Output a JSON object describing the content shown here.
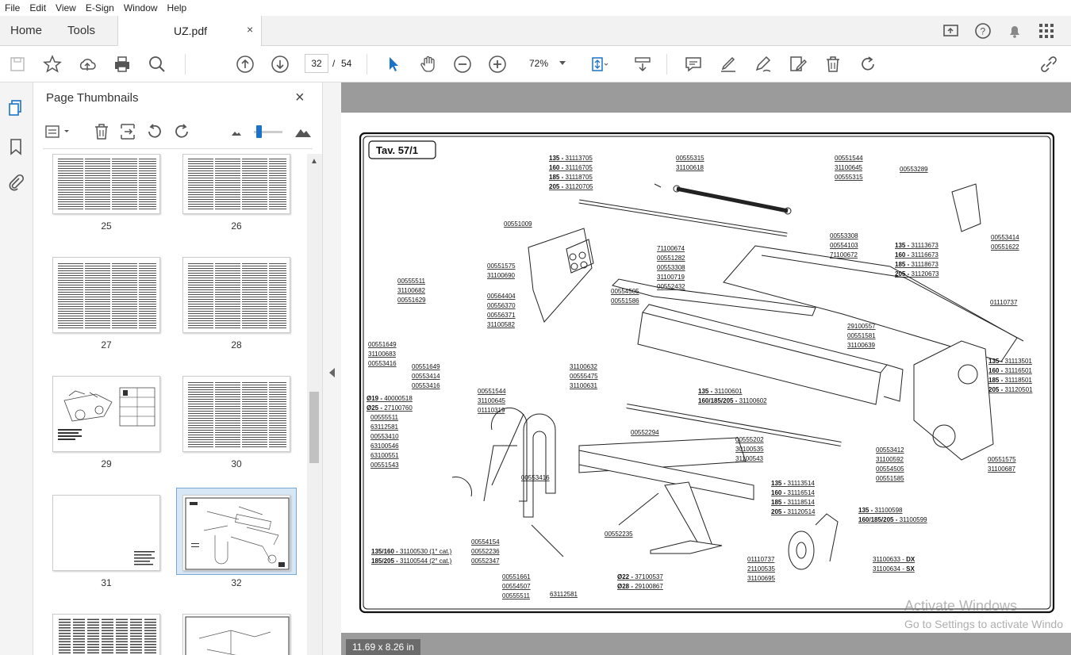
{
  "menu": [
    "File",
    "Edit",
    "View",
    "E-Sign",
    "Window",
    "Help"
  ],
  "tabs": {
    "home": "Home",
    "tools": "Tools",
    "document": "UZ.pdf",
    "close": "×"
  },
  "toolbar": {
    "current_page": "32",
    "separator": "/",
    "total_pages": "54",
    "zoom": "72%"
  },
  "thumbnails_panel": {
    "title": "Page Thumbnails",
    "close": "×",
    "pages": [
      "25",
      "26",
      "27",
      "28",
      "29",
      "30",
      "31",
      "32"
    ],
    "selected": "32"
  },
  "drawing": {
    "title": "Tav. 57/1",
    "callouts": [
      {
        "lines": [
          {
            "text": "135 - ",
            "bold": true
          },
          {
            "text": "31113705"
          }
        ]
      },
      {
        "lines": [
          {
            "text": "160 - ",
            "bold": true
          },
          {
            "text": "31116705"
          }
        ]
      },
      {
        "lines": [
          {
            "text": "185 - ",
            "bold": true
          },
          {
            "text": "31118705"
          }
        ]
      },
      {
        "lines": [
          {
            "text": "205 - ",
            "bold": true
          },
          {
            "text": "31120705"
          }
        ]
      },
      {
        "text": "00555315"
      },
      {
        "text": "31100618"
      },
      {
        "text": "00551544"
      },
      {
        "text": "31100645"
      },
      {
        "text": "00555315"
      },
      {
        "text": "00553289"
      },
      {
        "text": "00551009"
      },
      {
        "text": "00553308"
      },
      {
        "text": "00554103"
      },
      {
        "text": "71100672"
      },
      {
        "text": "71100674"
      },
      {
        "text": "00551282"
      },
      {
        "text": "00553308"
      },
      {
        "text": "31100719"
      },
      {
        "text": "00552432"
      },
      {
        "lines": [
          {
            "text": "135 - ",
            "bold": true
          },
          {
            "text": "31113673"
          }
        ]
      },
      {
        "lines": [
          {
            "text": "160 - ",
            "bold": true
          },
          {
            "text": "31116673"
          }
        ]
      },
      {
        "lines": [
          {
            "text": "185 - ",
            "bold": true
          },
          {
            "text": "31118673"
          }
        ]
      },
      {
        "lines": [
          {
            "text": "205 - ",
            "bold": true
          },
          {
            "text": "31120673"
          }
        ]
      },
      {
        "text": "00553414"
      },
      {
        "text": "00551622"
      },
      {
        "text": "00551575"
      },
      {
        "text": "31100690"
      },
      {
        "text": "00555511"
      },
      {
        "text": "31100682"
      },
      {
        "text": "00551629"
      },
      {
        "text": "00564404"
      },
      {
        "text": "00556370"
      },
      {
        "text": "00556371"
      },
      {
        "text": "31100582"
      },
      {
        "text": "00554505"
      },
      {
        "text": "00551586"
      },
      {
        "text": "01110737"
      },
      {
        "text": "00551649"
      },
      {
        "text": "31100683"
      },
      {
        "text": "00553416"
      },
      {
        "text": "29100557"
      },
      {
        "text": "00551581"
      },
      {
        "text": "31100639"
      },
      {
        "text": "00551649"
      },
      {
        "text": "00553414"
      },
      {
        "text": "00553416"
      },
      {
        "text": "31100632"
      },
      {
        "text": "00555475"
      },
      {
        "text": "31100631"
      },
      {
        "lines": [
          {
            "text": "135 - ",
            "bold": true
          },
          {
            "text": "31113501"
          }
        ]
      },
      {
        "lines": [
          {
            "text": "160 - ",
            "bold": true
          },
          {
            "text": "31116501"
          }
        ]
      },
      {
        "lines": [
          {
            "text": "185 - ",
            "bold": true
          },
          {
            "text": "31118501"
          }
        ]
      },
      {
        "lines": [
          {
            "text": "205 - ",
            "bold": true
          },
          {
            "text": "31120501"
          }
        ]
      },
      {
        "text": "00551544"
      },
      {
        "text": "31100645"
      },
      {
        "text": "01110319"
      },
      {
        "lines": [
          {
            "text": "135 - ",
            "bold": true
          },
          {
            "text": "31100601"
          }
        ]
      },
      {
        "lines": [
          {
            "text": "160/185/205 - ",
            "bold": true
          },
          {
            "text": "31100602"
          }
        ]
      },
      {
        "lines": [
          {
            "text": "Ø19 - ",
            "bold": true
          },
          {
            "text": "40000518"
          }
        ]
      },
      {
        "lines": [
          {
            "text": "Ø25 - ",
            "bold": true
          },
          {
            "text": "27100760"
          }
        ]
      },
      {
        "text": "00555511"
      },
      {
        "text": "63112581"
      },
      {
        "text": "00553410"
      },
      {
        "text": "63100546"
      },
      {
        "text": "63100551"
      },
      {
        "text": "00551543"
      },
      {
        "text": "00552294"
      },
      {
        "text": "00555202"
      },
      {
        "text": "30100535"
      },
      {
        "text": "31100543"
      },
      {
        "text": "00553412"
      },
      {
        "text": "31100592"
      },
      {
        "text": "00554505"
      },
      {
        "text": "00551585"
      },
      {
        "text": "00551575"
      },
      {
        "text": "31100687"
      },
      {
        "text": "00553416"
      },
      {
        "lines": [
          {
            "text": "135 - ",
            "bold": true
          },
          {
            "text": "31113514"
          }
        ]
      },
      {
        "lines": [
          {
            "text": "160 - ",
            "bold": true
          },
          {
            "text": "31116514"
          }
        ]
      },
      {
        "lines": [
          {
            "text": "185 - ",
            "bold": true
          },
          {
            "text": "31118514"
          }
        ]
      },
      {
        "lines": [
          {
            "text": "205 - ",
            "bold": true
          },
          {
            "text": "31120514"
          }
        ]
      },
      {
        "lines": [
          {
            "text": "135 - ",
            "bold": true
          },
          {
            "text": "31100598"
          }
        ]
      },
      {
        "lines": [
          {
            "text": "160/185/205 - ",
            "bold": true
          },
          {
            "text": "31100599"
          }
        ]
      },
      {
        "text": "00554154"
      },
      {
        "text": "00552236"
      },
      {
        "text": "00552347"
      },
      {
        "text": "00552235"
      },
      {
        "lines": [
          {
            "text": "135/160 - ",
            "bold": true
          },
          {
            "text": "31100530 (1° cat.)"
          }
        ]
      },
      {
        "lines": [
          {
            "text": "185/205 - ",
            "bold": true
          },
          {
            "text": "31100544 (2° cat.)"
          }
        ]
      },
      {
        "text": "01110737"
      },
      {
        "text": "21100535"
      },
      {
        "text": "31100695"
      },
      {
        "lines": [
          {
            "text": "31100633 - "
          },
          {
            "text": "DX",
            "bold": true
          }
        ]
      },
      {
        "lines": [
          {
            "text": "31100634 - "
          },
          {
            "text": "SX",
            "bold": true
          }
        ]
      },
      {
        "text": "00551661"
      },
      {
        "text": "00554507"
      },
      {
        "text": "00555511"
      },
      {
        "text": "63112581"
      },
      {
        "lines": [
          {
            "text": "Ø22 - ",
            "bold": true
          },
          {
            "text": "37100537"
          }
        ]
      },
      {
        "lines": [
          {
            "text": "Ø28 - ",
            "bold": true
          },
          {
            "text": "29100867"
          }
        ]
      }
    ]
  },
  "status": {
    "page_size": "11.69 x 8.26 in"
  },
  "watermark": {
    "line1": "Activate Windows",
    "line2": "Go to Settings to activate Windo"
  }
}
